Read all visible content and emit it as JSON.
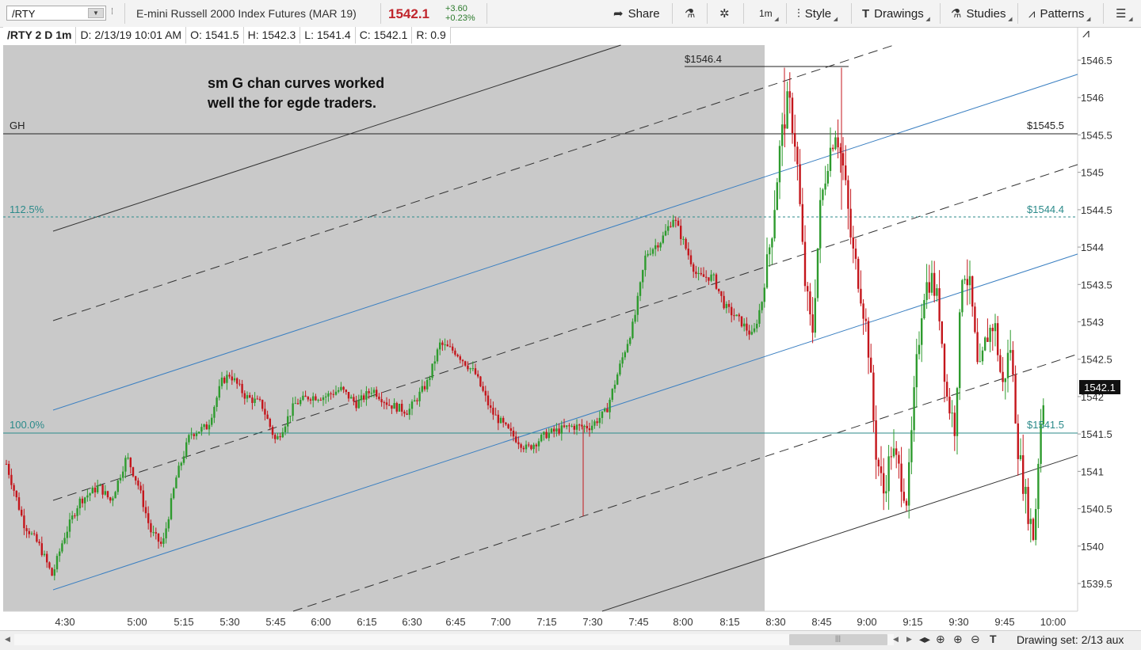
{
  "toolbar": {
    "symbol": "/RTY",
    "description": "E-mini Russell 2000 Index Futures (MAR 19)",
    "last_price": "1542.1",
    "change_abs": "+3.60",
    "change_pct": "+0.23%",
    "share": "Share",
    "interval": "1m",
    "style": "Style",
    "drawings": "Drawings",
    "studies": "Studies",
    "patterns": "Patterns"
  },
  "info": {
    "symbol": "/RTY 2 D 1m",
    "date": "D: 2/13/19 10:01 AM",
    "open": "O: 1541.5",
    "high": "H: 1542.3",
    "low": "L: 1541.4",
    "close": "C: 1542.1",
    "range": "R: 0.9"
  },
  "annotations": {
    "note_line1": "sm G chan curves worked",
    "note_line2": "well the for egde traders.",
    "gh_label": "GH",
    "gh_price": "$1545.5",
    "fib_112_label": "112.5%",
    "fib_112_price": "$1544.4",
    "fib_100_label": "100.0%",
    "fib_100_price": "$1541.5",
    "high_marker": "$1546.4",
    "current_price_tag": "1542.1"
  },
  "colors": {
    "up": "#2e9b2e",
    "down": "#c4161c",
    "premarket_bg": "#c9c9c9",
    "fib": "#2b8a8a",
    "channel": "#3a7fc1",
    "price_tag": "#111111"
  },
  "chart_data": {
    "type": "candlestick",
    "y_ticks": [
      "1546.5",
      "1546",
      "1545.5",
      "1545",
      "1544.5",
      "1544",
      "1543.5",
      "1543",
      "1542.5",
      "1542",
      "1541.5",
      "1541",
      "1540.5",
      "1540",
      "1539.5"
    ],
    "x_ticks": [
      "4:30",
      "5:00",
      "5:15",
      "5:30",
      "5:45",
      "6:00",
      "6:15",
      "6:30",
      "6:45",
      "7:00",
      "7:15",
      "7:30",
      "7:45",
      "8:00",
      "8:15",
      "8:30",
      "8:45",
      "9:00",
      "9:15",
      "9:30",
      "9:45",
      "10:00"
    ],
    "ylim": [
      1539.2,
      1546.9
    ],
    "horizontal_levels": [
      {
        "label": "GH",
        "value": 1545.5
      },
      {
        "label": "112.5%",
        "value": 1544.4
      },
      {
        "label": "100.0%",
        "value": 1541.5
      }
    ],
    "session_high": 1546.4,
    "last": 1542.1
  },
  "bottom": {
    "drawing_set": "Drawing set: 2/13 aux"
  }
}
